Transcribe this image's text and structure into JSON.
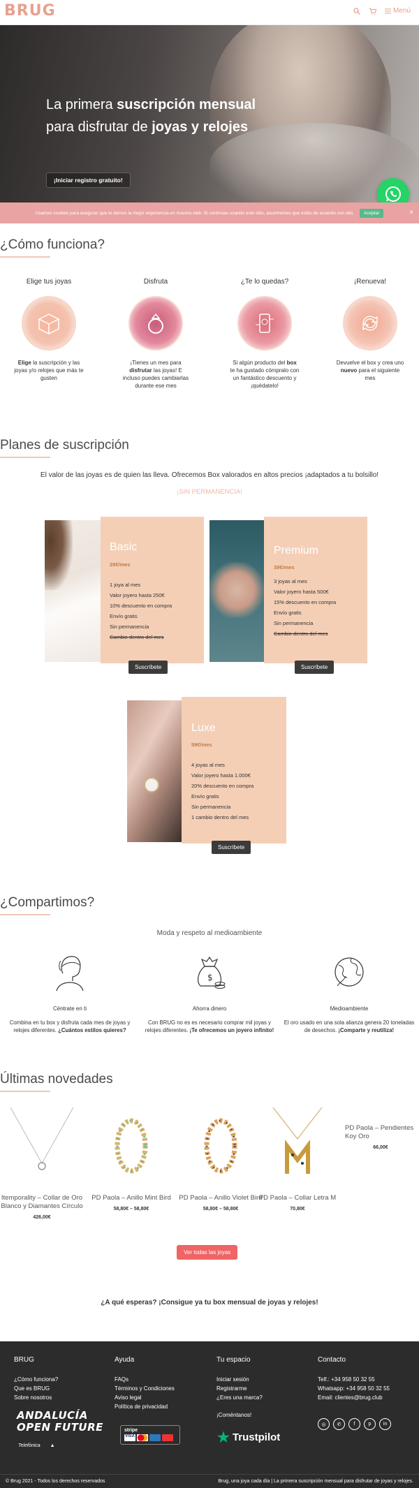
{
  "brand": {
    "logo": "BRUG",
    "accent": "#e9a08f"
  },
  "header": {
    "menu_label": "Menú"
  },
  "hero": {
    "title_line1_normal": "La primera ",
    "title_line1_bold": "suscripción mensual",
    "title_line2_normal": "para disfrutar de ",
    "title_line2_bold": "joyas y relojes",
    "cta": "¡Iniciar registro gratuito!"
  },
  "cookie": {
    "text": "Usamos cookies para asegurar que te damos la mejor experiencia en nuestra web. Si continúas usando este sitio, asumiremos que estás de acuerdo con ello.",
    "accept": "Aceptar"
  },
  "how": {
    "title": "¿Cómo funciona?",
    "steps": [
      {
        "title": "Elige tus joyas",
        "text_bold": "Elige",
        "text": " la suscripción y las joyas y/o relojes que más te gusten",
        "icon": "box-icon"
      },
      {
        "title": "Disfruta",
        "text_pre": "¡Tienes un mes para ",
        "text_bold": "disfrutar",
        "text": " las joyas! E incluso puedes cambiarlas durante ese mes",
        "icon": "ring-icon"
      },
      {
        "title": "¿Te lo quedas?",
        "text_pre": "Si algún producto del ",
        "text_bold": "box",
        "text": " te ha gustado cómpralo con un fantástico descuento y ¡quédatelo!",
        "icon": "phone-shop-icon"
      },
      {
        "title": "¡Renueva!",
        "text_pre": "Devuelve el box y crea uno ",
        "text_bold": "nuevo",
        "text": " para el siguiente mes",
        "icon": "renew-icon"
      }
    ]
  },
  "plans": {
    "title": "Planes de suscripción",
    "intro": "El valor de las joyas es de quien las lleva. Ofrecemos Box valorados en altos precios ¡adaptados a tu bolsillo!",
    "permanence": "¡SIN PERMANENCIA!",
    "items": [
      {
        "name": "Basic",
        "price": "29€/mes",
        "features": [
          "1 joya al mes",
          "Valor joyero hasta 250€",
          "10% descuento en compra",
          "Envío gratis",
          "Sin permanencia"
        ],
        "struck": "Cambio dentro del mes",
        "button": "Suscríbete"
      },
      {
        "name": "Premium",
        "price": "39€/mes",
        "features": [
          "3 joyas al mes",
          "Valor joyero hasta 500€",
          "15% descuento en compra",
          "Envío gratis",
          "Sin permanencia"
        ],
        "struck": "Cambio dentro del mes",
        "button": "Suscríbete"
      },
      {
        "name": "Luxe",
        "price": "59€/mes",
        "features": [
          "4 joyas al mes",
          "Valor joyero hasta 1.000€",
          "20% descuento en compra",
          "Envío gratis",
          "Sin permanencia",
          "1 cambio dentro del mes"
        ],
        "struck": "",
        "button": "Suscríbete"
      }
    ]
  },
  "share": {
    "title": "¿Compartimos?",
    "subtitle": "Moda y respeto al medioambiente",
    "cols": [
      {
        "title": "Céntrate en ti",
        "text": "Combina en tu box y disfruta cada mes de joyas y relojes diferentes. ",
        "bold": "¿Cuántos estilos quieres?",
        "icon": "person-icon"
      },
      {
        "title": "Ahorra dinero",
        "text": "Con BRUG no es es necesario comprar mil joyas y relojes diferentes. ",
        "bold": "¡Te ofrecemos un joyero infinito!",
        "icon": "money-bag-icon"
      },
      {
        "title": "Medioambiente",
        "text": "El oro usado en una sola alianza genera 20 toneladas de desechos. ",
        "bold": "¡Comparte y reutiliza!",
        "icon": "globe-icon"
      }
    ]
  },
  "news": {
    "title": "Últimas novedades",
    "products": [
      {
        "name": "Itemporality – Collar de Oro Blanco y Diamantes Círculo",
        "price": "426,00€"
      },
      {
        "name": "PD Paola – Anillo Mint Bird",
        "price": "58,80€ – 58,80€"
      },
      {
        "name": "PD Paola – Anillo Violet Bird",
        "price": "58,80€ – 58,80€"
      },
      {
        "name": "PD Paola – Collar Letra M",
        "price": "70,80€"
      },
      {
        "name": "PD Paola – Pendientes Koy Oro",
        "price": "66,00€"
      }
    ],
    "see_all": "Ver todas las joyas",
    "cta": "¿A qué esperas? ¡Consigue ya tu box mensual de joyas y relojes!"
  },
  "footer": {
    "cols": [
      {
        "title": "BRUG",
        "links": [
          "¿Cómo funciona?",
          "Que es BRUG",
          "Sobre nosotros"
        ]
      },
      {
        "title": "Ayuda",
        "links": [
          "FAQs",
          "Términos y Condiciones",
          "Aviso legal",
          "Política de privacidad"
        ]
      },
      {
        "title": "Tu espacio",
        "links": [
          "Iniciar sesión",
          "Registrarme",
          "¿Eres una marca?"
        ]
      },
      {
        "title": "Contacto",
        "links": [
          "Telf.: +34 958 50 32 55",
          "Whatsapp: +34 958 50 32 55",
          "Email: clientes@brug.club"
        ]
      }
    ],
    "comment": "¡Coméntanos!",
    "andalucia_1": "ANDALUCÍA",
    "andalucia_2": "OPEN FUTURE",
    "telefonica": "Telefónica",
    "stripe": "stripe",
    "trustpilot": "Trustpilot",
    "copyright": "© Brug 2021 - Todos los derechos reservados",
    "tagline": "Brug, una joya cada día | La primera suscripción mensual para disfrutar de joyas y relojes."
  }
}
